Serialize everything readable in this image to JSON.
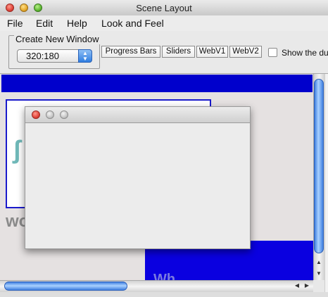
{
  "window": {
    "title": "Scene Layout"
  },
  "menubar": {
    "items": [
      "File",
      "Edit",
      "Help",
      "Look and Feel"
    ]
  },
  "toolbar": {
    "create_group_label": "Create New Window",
    "size_select_value": "320:180",
    "buttons": [
      "Progress Bars",
      "Sliders",
      "WebV1",
      "WebV2"
    ],
    "show_checkbox_label": "Show the du",
    "show_checkbox_checked": false
  },
  "scene": {
    "partial_text_left": "wo",
    "partial_text_bottom": "Wh",
    "colors": {
      "primary_blue": "#0000cc",
      "background": "#e5e1e1"
    }
  },
  "new_window": {
    "title": ""
  },
  "scrollbars": {
    "vertical_icons": [
      "arrow-up-icon",
      "arrow-down-icon"
    ],
    "horizontal_icons": [
      "arrow-left-icon",
      "arrow-right-icon"
    ]
  }
}
